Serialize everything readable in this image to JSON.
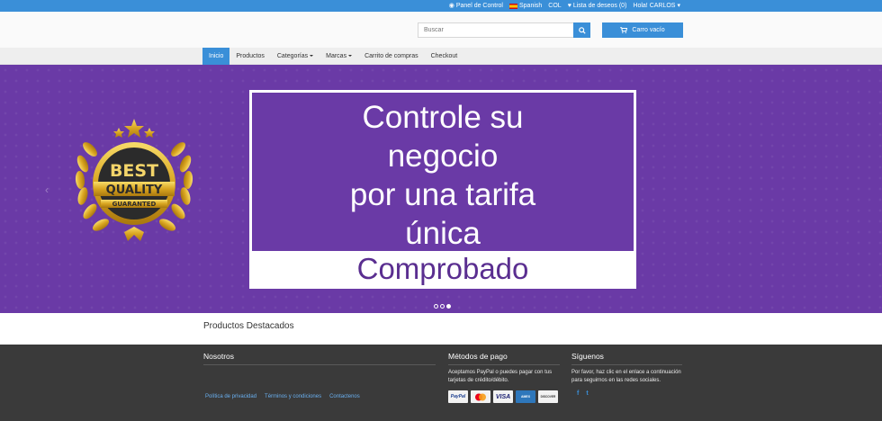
{
  "topbar": {
    "control_panel": "Panel de Control",
    "language": "Spanish",
    "currency": "COL",
    "wishlist": "Lista de deseos (0)",
    "greeting": "Hola! CARLOS"
  },
  "header": {
    "search_placeholder": "Buscar",
    "cart_label": "Carro vacío"
  },
  "nav": {
    "items": [
      {
        "label": "Inicio"
      },
      {
        "label": "Productos"
      },
      {
        "label": "Categorías"
      },
      {
        "label": "Marcas"
      },
      {
        "label": "Carrito de compras"
      },
      {
        "label": "Checkout"
      }
    ]
  },
  "banner": {
    "badge": {
      "line1": "BEST",
      "line2": "QUALITY",
      "line3": "GUARANTED"
    },
    "promo_lines": [
      "Controle su",
      "negocio",
      "por una tarifa",
      "única"
    ],
    "promo_strip": "Comprobado",
    "slide_count": 3,
    "active_slide": 3
  },
  "featured": {
    "title": "Productos Destacados"
  },
  "footer": {
    "about": {
      "title": "Nosotros"
    },
    "links": [
      "Política de privacidad",
      "Términos y condiciones",
      "Contactenos"
    ],
    "payments": {
      "title": "Métodos de pago",
      "text": "Aceptamos PayPal o puedes pagar con tus tarjetas de crédito/débito.",
      "cards": [
        "PayPal",
        "MasterCard",
        "VISA",
        "AMEX",
        "DISCOVER"
      ]
    },
    "social": {
      "title": "Síguenos",
      "text": "Por favor, haz clic en el enlace a continuación para seguirnos en las redes sociales.",
      "icons": [
        "f",
        "t"
      ]
    }
  },
  "colors": {
    "accent": "#3a8fd8",
    "banner": "#6a3aa6",
    "footer": "#3a3a3a"
  }
}
